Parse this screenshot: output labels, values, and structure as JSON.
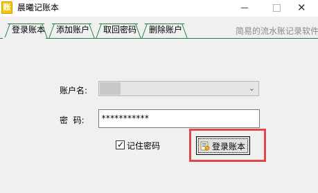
{
  "window": {
    "title": "晨曦记账本",
    "icon_glyph": "账",
    "icon_name": "ledger-app-icon"
  },
  "tabs": [
    {
      "label": "登录账本",
      "active": true
    },
    {
      "label": "添加账户",
      "active": false
    },
    {
      "label": "取回密码",
      "active": false
    },
    {
      "label": "删除账户",
      "active": false
    }
  ],
  "slogan": "简易的流水账记录软件",
  "form": {
    "account_label": "账户名:",
    "account_value": "",
    "password_label": "密  码:",
    "password_value": "***********",
    "remember_label": "记住密码",
    "remember_checked": true,
    "login_button_label": "登录账本"
  },
  "colors": {
    "tab_border": "#1e7f3d",
    "highlight": "#e0474c"
  }
}
